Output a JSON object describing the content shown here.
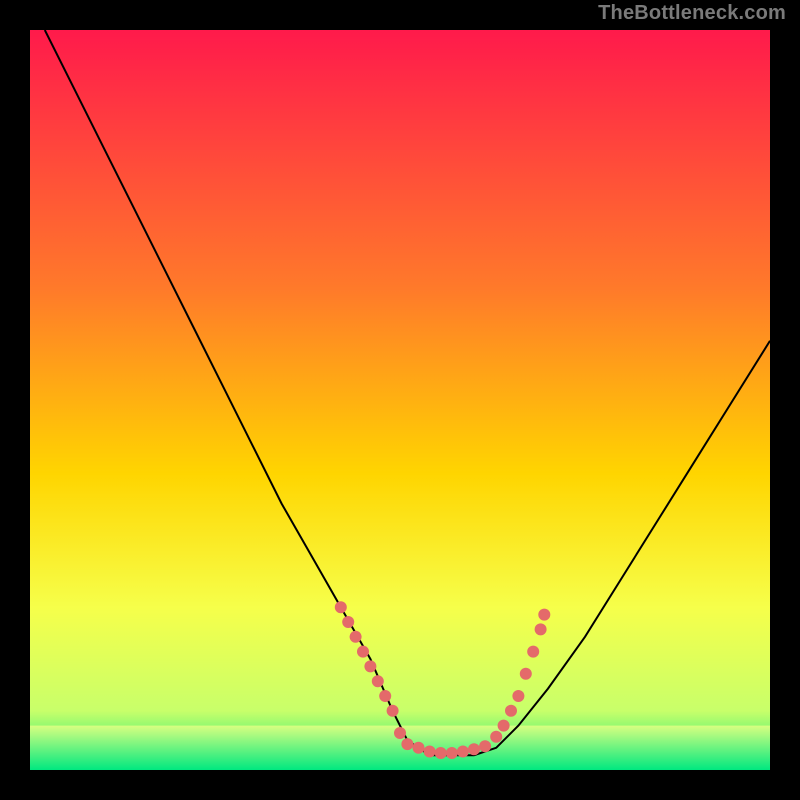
{
  "attribution": "TheBottleneck.com",
  "chart_data": {
    "type": "line",
    "title": "",
    "xlabel": "",
    "ylabel": "",
    "xlim": [
      0,
      100
    ],
    "ylim": [
      0,
      100
    ],
    "grid": false,
    "legend": false,
    "background_gradient": {
      "stops": [
        {
          "offset": 0.0,
          "color": "#ff1a4b"
        },
        {
          "offset": 0.35,
          "color": "#ff7a2a"
        },
        {
          "offset": 0.6,
          "color": "#ffd500"
        },
        {
          "offset": 0.78,
          "color": "#f6ff4a"
        },
        {
          "offset": 0.92,
          "color": "#c8ff6a"
        },
        {
          "offset": 1.0,
          "color": "#00e880"
        }
      ]
    },
    "series": [
      {
        "name": "bottleneck-curve",
        "color": "#000000",
        "x": [
          2,
          6,
          10,
          14,
          18,
          22,
          26,
          30,
          34,
          38,
          42,
          46,
          49,
          51,
          54,
          57,
          60,
          63,
          66,
          70,
          75,
          80,
          85,
          90,
          95,
          100
        ],
        "y": [
          100,
          92,
          84,
          76,
          68,
          60,
          52,
          44,
          36,
          29,
          22,
          15,
          8,
          4,
          2,
          2,
          2,
          3,
          6,
          11,
          18,
          26,
          34,
          42,
          50,
          58
        ]
      }
    ],
    "markers": [
      {
        "name": "highlight-dots-left",
        "color": "#e46a6a",
        "radius": 6,
        "points": [
          {
            "x": 42.0,
            "y": 22
          },
          {
            "x": 43.0,
            "y": 20
          },
          {
            "x": 44.0,
            "y": 18
          },
          {
            "x": 45.0,
            "y": 16
          },
          {
            "x": 46.0,
            "y": 14
          },
          {
            "x": 47.0,
            "y": 12
          },
          {
            "x": 48.0,
            "y": 10
          },
          {
            "x": 49.0,
            "y": 8
          },
          {
            "x": 50.0,
            "y": 5
          }
        ]
      },
      {
        "name": "highlight-dots-bottom",
        "color": "#e46a6a",
        "radius": 6,
        "points": [
          {
            "x": 51.0,
            "y": 3.5
          },
          {
            "x": 52.5,
            "y": 3.0
          },
          {
            "x": 54.0,
            "y": 2.5
          },
          {
            "x": 55.5,
            "y": 2.3
          },
          {
            "x": 57.0,
            "y": 2.3
          },
          {
            "x": 58.5,
            "y": 2.5
          },
          {
            "x": 60.0,
            "y": 2.8
          },
          {
            "x": 61.5,
            "y": 3.2
          }
        ]
      },
      {
        "name": "highlight-dots-right",
        "color": "#e46a6a",
        "radius": 6,
        "points": [
          {
            "x": 63.0,
            "y": 4.5
          },
          {
            "x": 64.0,
            "y": 6.0
          },
          {
            "x": 65.0,
            "y": 8.0
          },
          {
            "x": 66.0,
            "y": 10.0
          },
          {
            "x": 67.0,
            "y": 13.0
          },
          {
            "x": 68.0,
            "y": 16.0
          },
          {
            "x": 69.0,
            "y": 19.0
          },
          {
            "x": 69.5,
            "y": 21.0
          }
        ]
      }
    ],
    "green_band": {
      "name": "optimal-zone",
      "y_from": 0,
      "y_to": 6,
      "color_top": "#d8ff80",
      "color_bottom": "#00e880"
    }
  }
}
